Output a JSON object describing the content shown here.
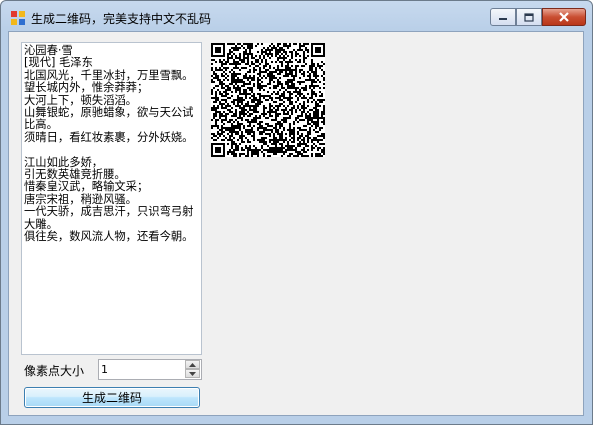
{
  "window": {
    "title": "生成二维码，完美支持中文不乱码",
    "app_icon": "app-icon",
    "controls": [
      "minimize-icon",
      "maximize-icon",
      "close-icon"
    ]
  },
  "main": {
    "poem_text": "沁园春·雪\n[现代] 毛泽东\n北国风光，千里冰封，万里雪飘。\n望长城内外，惟余莽莽；\n大河上下，顿失滔滔。\n山舞银蛇，原驰蜡象，欲与天公试比高。\n须晴日，看红妆素裹，分外妖娆。\n\n江山如此多娇，\n引无数英雄竞折腰。\n惜秦皇汉武，略输文采；\n唐宗宋祖，稍逊风骚。\n一代天骄，成吉思汗，只识弯弓射大雕。\n俱往矣，数风流人物，还看今朝。",
    "qr_code": "qr-code-image",
    "pixel_size_label": "像素点大小",
    "pixel_size_value": "1",
    "generate_button": "生成二维码"
  },
  "colors": {
    "titlebar": "#b9cfe8",
    "client_bg": "#f0f0f0",
    "button_border": "#3c7fb1",
    "close_button": "#c94e32"
  }
}
